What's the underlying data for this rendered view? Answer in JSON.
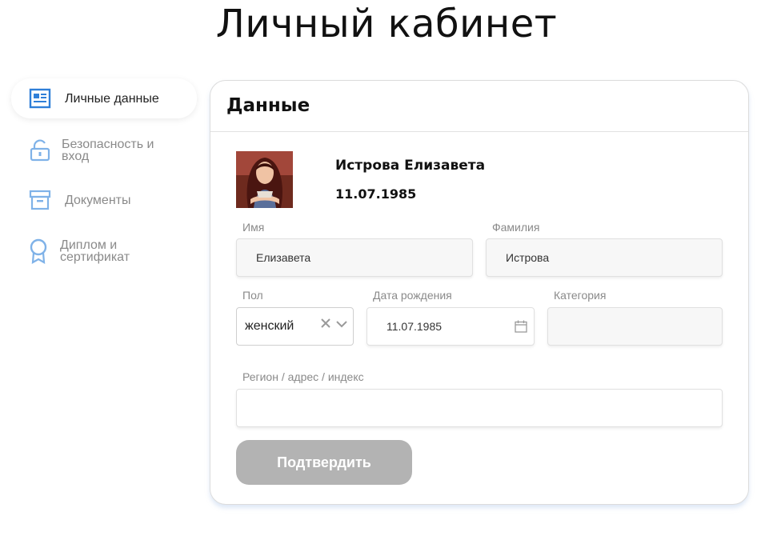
{
  "page": {
    "title": "Личный кабинет"
  },
  "sidebar": {
    "items": [
      {
        "label": "Личные данные",
        "icon": "profile-card-icon",
        "active": true
      },
      {
        "label": "Безопасность и вход",
        "icon": "unlock-icon",
        "active": false
      },
      {
        "label": "Документы",
        "icon": "archive-box-icon",
        "active": false
      },
      {
        "label": "Диплом и сертификат",
        "icon": "award-ribbon-icon",
        "active": false
      }
    ]
  },
  "card": {
    "title": "Данные",
    "profile": {
      "full_name": "Истрова Елизавета",
      "birth_date": "11.07.1985",
      "avatar_icon": "user-avatar"
    },
    "fields": {
      "first_name": {
        "label": "Имя",
        "value": "Елизавета"
      },
      "last_name": {
        "label": "Фамилия",
        "value": "Истрова"
      },
      "gender": {
        "label": "Пол",
        "value": "женский"
      },
      "birth_date": {
        "label": "Дата рождения",
        "value": "11.07.1985"
      },
      "category": {
        "label": "Категория",
        "value": ""
      },
      "region": {
        "label": "Регион / адрес / индекс",
        "value": ""
      }
    },
    "submit_label": "Подтвердить"
  },
  "colors": {
    "accent": "#2f7fd8",
    "icon_light": "#7fb2e8",
    "button_disabled": "#b3b3b3"
  }
}
